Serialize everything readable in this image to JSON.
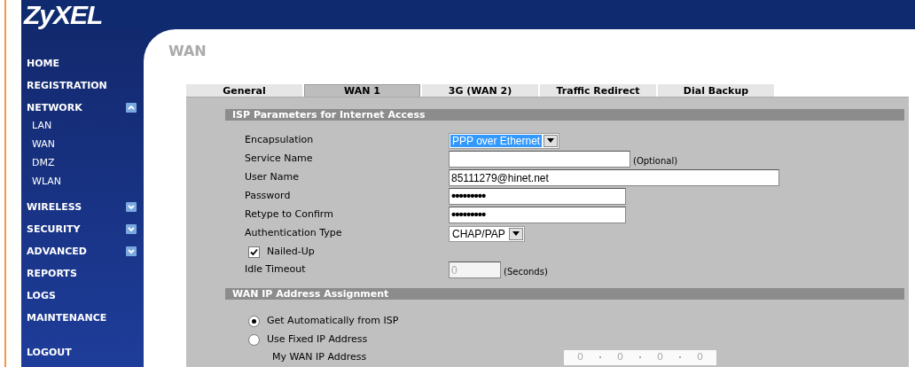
{
  "logo": {
    "text": "ZyXEL"
  },
  "sidebar": {
    "items": [
      {
        "label": "HOME",
        "kind": "item"
      },
      {
        "label": "REGISTRATION",
        "kind": "item"
      },
      {
        "label": "NETWORK",
        "kind": "group",
        "expanded": true,
        "children": [
          {
            "label": "LAN"
          },
          {
            "label": "WAN"
          },
          {
            "label": "DMZ"
          },
          {
            "label": "WLAN"
          }
        ]
      },
      {
        "label": "WIRELESS",
        "kind": "group",
        "expanded": false
      },
      {
        "label": "SECURITY",
        "kind": "group",
        "expanded": false
      },
      {
        "label": "ADVANCED",
        "kind": "group",
        "expanded": false
      },
      {
        "label": "REPORTS",
        "kind": "item"
      },
      {
        "label": "LOGS",
        "kind": "item"
      },
      {
        "label": "MAINTENANCE",
        "kind": "item"
      }
    ],
    "logout": "LOGOUT"
  },
  "page_title": "WAN",
  "tabs": [
    {
      "label": "General",
      "selected": false
    },
    {
      "label": "WAN 1",
      "selected": true
    },
    {
      "label": "3G (WAN 2)",
      "selected": false
    },
    {
      "label": "Traffic Redirect",
      "selected": false
    },
    {
      "label": "Dial Backup",
      "selected": false
    }
  ],
  "sections": [
    {
      "title": "ISP Parameters for Internet Access",
      "rows": [
        {
          "kind": "select",
          "label": "Encapsulation",
          "value": "PPP over Ethernet",
          "highlighted": true
        },
        {
          "kind": "input",
          "label": "Service Name",
          "value": "",
          "note": "(Optional)"
        },
        {
          "kind": "input",
          "label": "User Name",
          "value": "85111279@hinet.net"
        },
        {
          "kind": "password",
          "label": "Password",
          "value": "•••••••••"
        },
        {
          "kind": "password",
          "label": "Retype to Confirm",
          "value": "•••••••••"
        },
        {
          "kind": "select",
          "label": "Authentication Type",
          "value": "CHAP/PAP",
          "highlighted": false
        },
        {
          "kind": "checkbox",
          "label": "Nailed-Up",
          "checked": true
        },
        {
          "kind": "input",
          "label": "Idle Timeout",
          "value": "0",
          "note": "(Seconds)",
          "disabled": true
        }
      ]
    },
    {
      "title": "WAN IP Address Assignment",
      "rows": [
        {
          "kind": "radio",
          "label": "Get Automatically from ISP",
          "selected": true
        },
        {
          "kind": "radio",
          "label": "Use Fixed IP Address",
          "selected": false
        },
        {
          "kind": "ip",
          "label": "My WAN IP Address",
          "octets": [
            "0",
            "0",
            "0",
            "0"
          ],
          "disabled": true
        }
      ]
    }
  ]
}
